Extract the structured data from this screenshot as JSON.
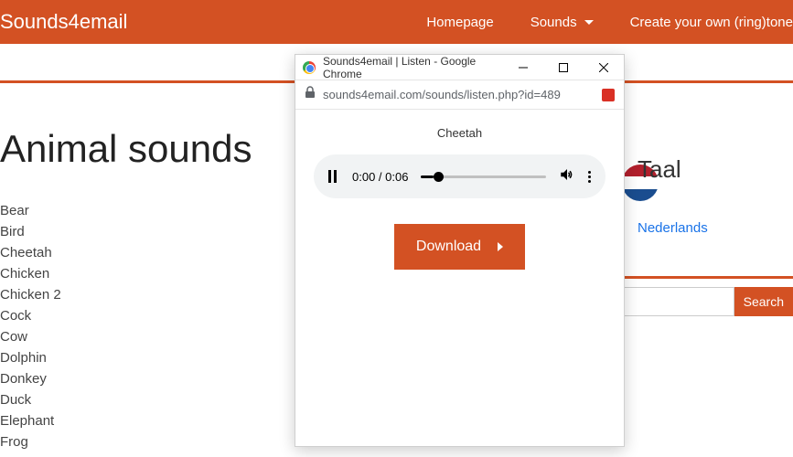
{
  "header": {
    "logo": "Sounds4email",
    "nav": {
      "homepage": "Homepage",
      "sounds": "Sounds",
      "create": "Create your own (ring)tone"
    }
  },
  "page": {
    "title": "Animal sounds",
    "sounds": [
      "Bear",
      "Bird",
      "Cheetah",
      "Chicken",
      "Chicken 2",
      "Cock",
      "Cow",
      "Dolphin",
      "Donkey",
      "Duck",
      "Elephant",
      "Frog"
    ]
  },
  "sidebar": {
    "taal_heading": "Taal",
    "language": "Nederlands",
    "search_btn": "Search"
  },
  "popup": {
    "window_title": "Sounds4email | Listen - Google Chrome",
    "url": "sounds4email.com/sounds/listen.php?id=489",
    "sound_title": "Cheetah",
    "time": "0:00 / 0:06",
    "download": "Download"
  }
}
